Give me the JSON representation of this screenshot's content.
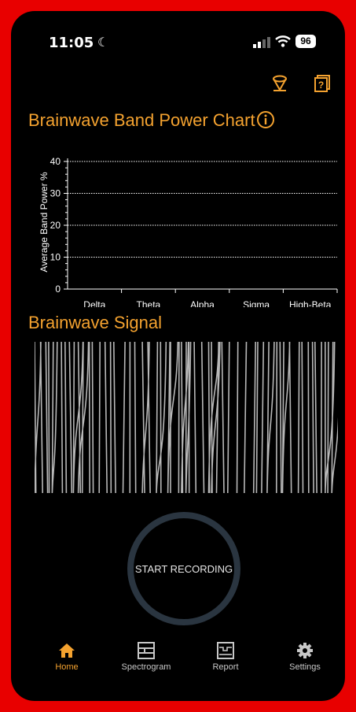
{
  "status_bar": {
    "time": "11:05",
    "battery": "96"
  },
  "icons": {
    "top_left": "sensor-headband-icon",
    "top_right": "help-book-icon",
    "info": "info-icon",
    "moon": "moon-icon"
  },
  "colors": {
    "accent": "#f4a22f",
    "background": "#000000",
    "frame": "#e80000",
    "signal_trace": "#b8b8b8",
    "ring": "#2a3540"
  },
  "band_chart": {
    "title": "Brainwave Band Power Chart"
  },
  "chart_data": {
    "type": "bar",
    "categories": [
      "Delta",
      "Theta",
      "Alpha",
      "Sigma",
      "High-Beta"
    ],
    "values": [
      0,
      0,
      0,
      0,
      0
    ],
    "ylabel": "Average Band Power %",
    "ylim": [
      0,
      40
    ],
    "yticks": [
      "0",
      "10",
      "20",
      "30",
      "40"
    ],
    "grid": true
  },
  "signal": {
    "title": "Brainwave Signal"
  },
  "record_button": {
    "label": "START RECORDING"
  },
  "tabs": [
    {
      "label": "Home",
      "icon": "home-icon",
      "active": true
    },
    {
      "label": "Spectrogram",
      "icon": "spectrogram-icon",
      "active": false
    },
    {
      "label": "Report",
      "icon": "report-icon",
      "active": false
    },
    {
      "label": "Settings",
      "icon": "gear-icon",
      "active": false
    }
  ]
}
